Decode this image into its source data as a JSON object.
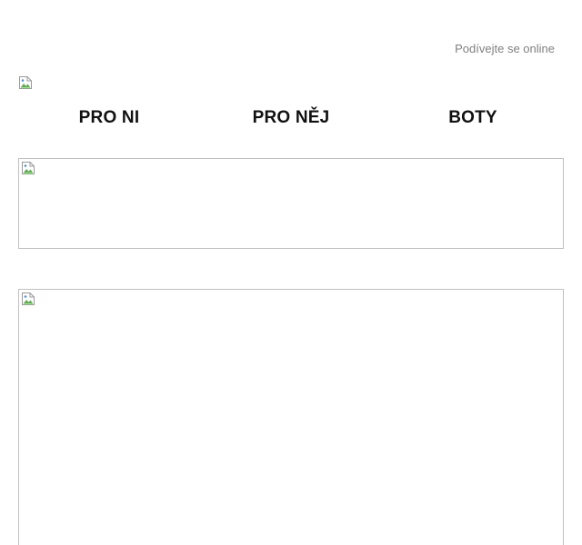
{
  "header": {
    "online_link_label": "Podívejte se online"
  },
  "logo": {
    "icon": "broken-image-icon"
  },
  "nav": {
    "items": [
      {
        "label": "PRO NI"
      },
      {
        "label": "PRO NĚJ"
      },
      {
        "label": "BOTY"
      }
    ]
  },
  "banners": [
    {
      "icon": "broken-image-icon"
    },
    {
      "icon": "broken-image-icon"
    }
  ]
}
